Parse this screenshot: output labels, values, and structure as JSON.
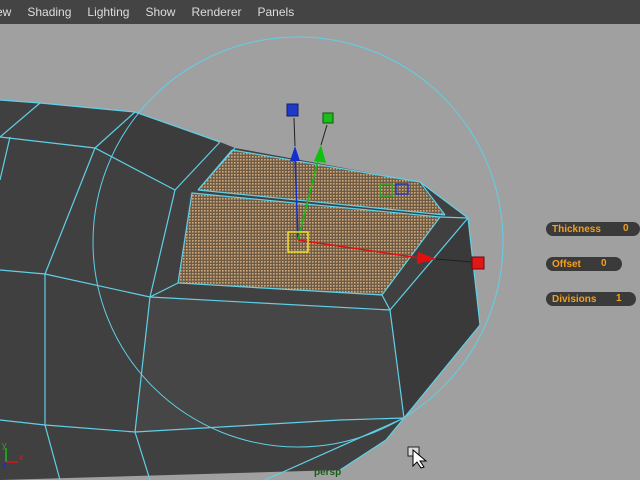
{
  "menu": {
    "items": [
      "ew",
      "Shading",
      "Lighting",
      "Show",
      "Renderer",
      "Panels"
    ]
  },
  "viewport": {
    "camera_label": "persp",
    "axis_x_label": "x",
    "axis_y_label": "y"
  },
  "tool_hud": {
    "thickness": {
      "label": "Thickness",
      "value": "0"
    },
    "offset": {
      "label": "Offset",
      "value": "0"
    },
    "divisions": {
      "label": "Divisions",
      "value": "1"
    }
  },
  "colors": {
    "background": "#a0a0a0",
    "mesh_face": "#404040",
    "wireframe": "#5fd0e8",
    "selected_face": "#c8a070",
    "hud_text": "#f2a01f",
    "axis_x": "#e01010",
    "axis_y": "#10c010",
    "axis_z": "#1030d0"
  },
  "icons": {
    "cursor": "arrow-pointer-icon",
    "manipulator": "move-manipulator-icon"
  }
}
